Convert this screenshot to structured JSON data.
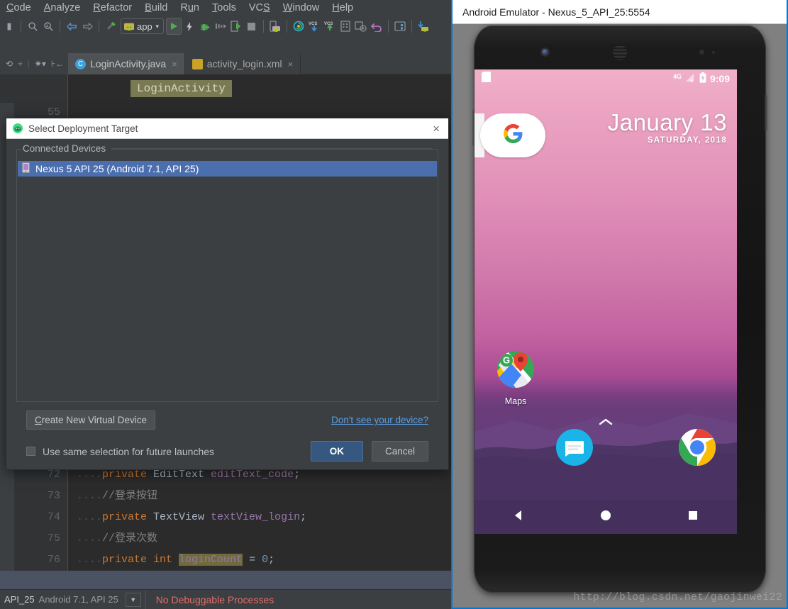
{
  "ide": {
    "menu": [
      "Code",
      "Analyze",
      "Refactor",
      "Build",
      "Run",
      "Tools",
      "VCS",
      "Window",
      "Help"
    ],
    "toolbar": {
      "module_label": "app",
      "icons": [
        "search-icon",
        "search-everywhere-icon",
        "back-icon",
        "forward-icon",
        "build-hammer-icon",
        "run-icon",
        "apply-changes-icon",
        "debug-icon",
        "step-icon",
        "attach-debugger-icon",
        "stop-icon",
        "avd-manager-icon",
        "sdk-manager-icon",
        "vcs-update-icon",
        "vcs-commit-icon",
        "project-structure-icon",
        "settings-icon",
        "undo-icon",
        "layout-inspector-icon",
        "sync-gradle-icon"
      ]
    },
    "tabs": [
      {
        "label": "LoginActivity.java",
        "icon": "java-class-icon",
        "active": true,
        "close": "×"
      },
      {
        "label": "activity_login.xml",
        "icon": "android-xml-icon",
        "active": false,
        "close": "×"
      }
    ],
    "breadcrumb": "LoginActivity",
    "editor_lines": [
      {
        "num": "55",
        "fold": "⊟",
        "tokens": [
          {
            "t": "/**",
            "c": "cm"
          }
        ]
      },
      {
        "num": "72",
        "fold": "",
        "tokens": [
          {
            "t": "....",
            "c": "dots"
          },
          {
            "t": "private ",
            "c": "kw"
          },
          {
            "t": "EditText ",
            "c": "typ"
          },
          {
            "t": "editText_code",
            "c": "fld"
          },
          {
            "t": ";",
            "c": "typ"
          }
        ]
      },
      {
        "num": "73",
        "fold": "",
        "tokens": [
          {
            "t": "....",
            "c": "dots"
          },
          {
            "t": "//登录按钮",
            "c": "cm"
          }
        ]
      },
      {
        "num": "74",
        "fold": "",
        "tokens": [
          {
            "t": "....",
            "c": "dots"
          },
          {
            "t": "private ",
            "c": "kw"
          },
          {
            "t": "TextView ",
            "c": "typ"
          },
          {
            "t": "textView_login",
            "c": "fld"
          },
          {
            "t": ";",
            "c": "typ"
          }
        ]
      },
      {
        "num": "75",
        "fold": "",
        "tokens": [
          {
            "t": "....",
            "c": "dots"
          },
          {
            "t": "//登录次数",
            "c": "cm"
          }
        ]
      },
      {
        "num": "76",
        "fold": "",
        "tokens": [
          {
            "t": "....",
            "c": "dots"
          },
          {
            "t": "private ",
            "c": "kw"
          },
          {
            "t": "int ",
            "c": "kw"
          },
          {
            "t": "loginCount",
            "c": "fld hl"
          },
          {
            "t": " = ",
            "c": "typ"
          },
          {
            "t": "0",
            "c": "num"
          },
          {
            "t": ";",
            "c": "typ"
          }
        ]
      }
    ],
    "statusbar": {
      "device_strong": "API_25",
      "device_dim": "Android 7.1, API 25",
      "combo_arrow": "▼",
      "process_text": "No Debuggable Processes",
      "process_color": "#e06c6c"
    }
  },
  "dialog": {
    "title": "Select Deployment Target",
    "title_icon": "android-studio-icon",
    "close_icon": "×",
    "group_legend": "Connected Devices",
    "devices": [
      {
        "icon": "phone-icon",
        "label": "Nexus 5 API 25 (Android 7.1, API 25)",
        "selected": true
      }
    ],
    "create_button": "Create New Virtual Device",
    "create_button_mnemonic": "C",
    "create_button_rest": "reate New Virtual Device",
    "help_link": "Don't see your device?",
    "checkbox_label": "Use same selection for future launches",
    "checkbox_checked": false,
    "ok_button": "OK",
    "cancel_button": "Cancel",
    "accent_selected": "#4b6eaf",
    "accent_ok": "#365880"
  },
  "emulator": {
    "window_title": "Android Emulator - Nexus_5_API_25:5554",
    "frame_accent": "#0078d7",
    "status": {
      "sim_icon": "sim-card-icon",
      "network_label": "4G",
      "signal_icon": "signal-bars-no-service-icon",
      "battery_icon": "battery-charging-icon",
      "clock": "9:09"
    },
    "widget": {
      "google_search_icon": "google-g-icon",
      "date_main": "January 13",
      "date_sub": "SATURDAY, 2018"
    },
    "home_apps": [
      {
        "icon": "google-maps-icon",
        "label": "Maps"
      }
    ],
    "app_drawer_handle": "chevron-up-icon",
    "dock": [
      {
        "icon": "messages-icon",
        "label": "Messages"
      },
      {
        "icon": "chrome-icon",
        "label": "Chrome"
      }
    ],
    "navbar": [
      {
        "icon": "back-nav-icon",
        "label": "Back"
      },
      {
        "icon": "home-nav-icon",
        "label": "Home"
      },
      {
        "icon": "recents-nav-icon",
        "label": "Recents"
      }
    ]
  },
  "watermark": "http://blog.csdn.net/gaojinwei22"
}
